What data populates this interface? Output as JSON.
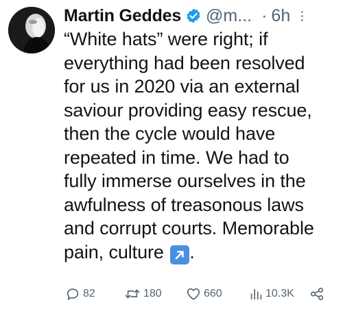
{
  "tweet": {
    "author_name": "Martin Geddes",
    "handle": "@m...",
    "separator": "·",
    "time": "6h",
    "lines": [
      "“White hats” were right; if",
      "everything had been resolved",
      "for us in 2020 via an external",
      "saviour providing easy rescue,",
      "then the cycle would have",
      "repeated in time. We had to",
      "fully immerse ourselves in the",
      "awfulness of treasonous laws",
      "and corrupt courts. Memorable"
    ],
    "last_line_text": "pain, culture",
    "last_line_end": ".",
    "actions": {
      "replies": "82",
      "retweets": "180",
      "likes": "660",
      "views": "10.3K"
    },
    "colors": {
      "verified": "#1d9bf0",
      "arrow_emoji_bg": "#4a90e2",
      "muted": "#536471"
    },
    "icons": [
      "verified-badge-icon",
      "more-options-icon",
      "arrow-up-right-icon",
      "reply-icon",
      "retweet-icon",
      "like-icon",
      "views-icon",
      "share-icon"
    ]
  }
}
